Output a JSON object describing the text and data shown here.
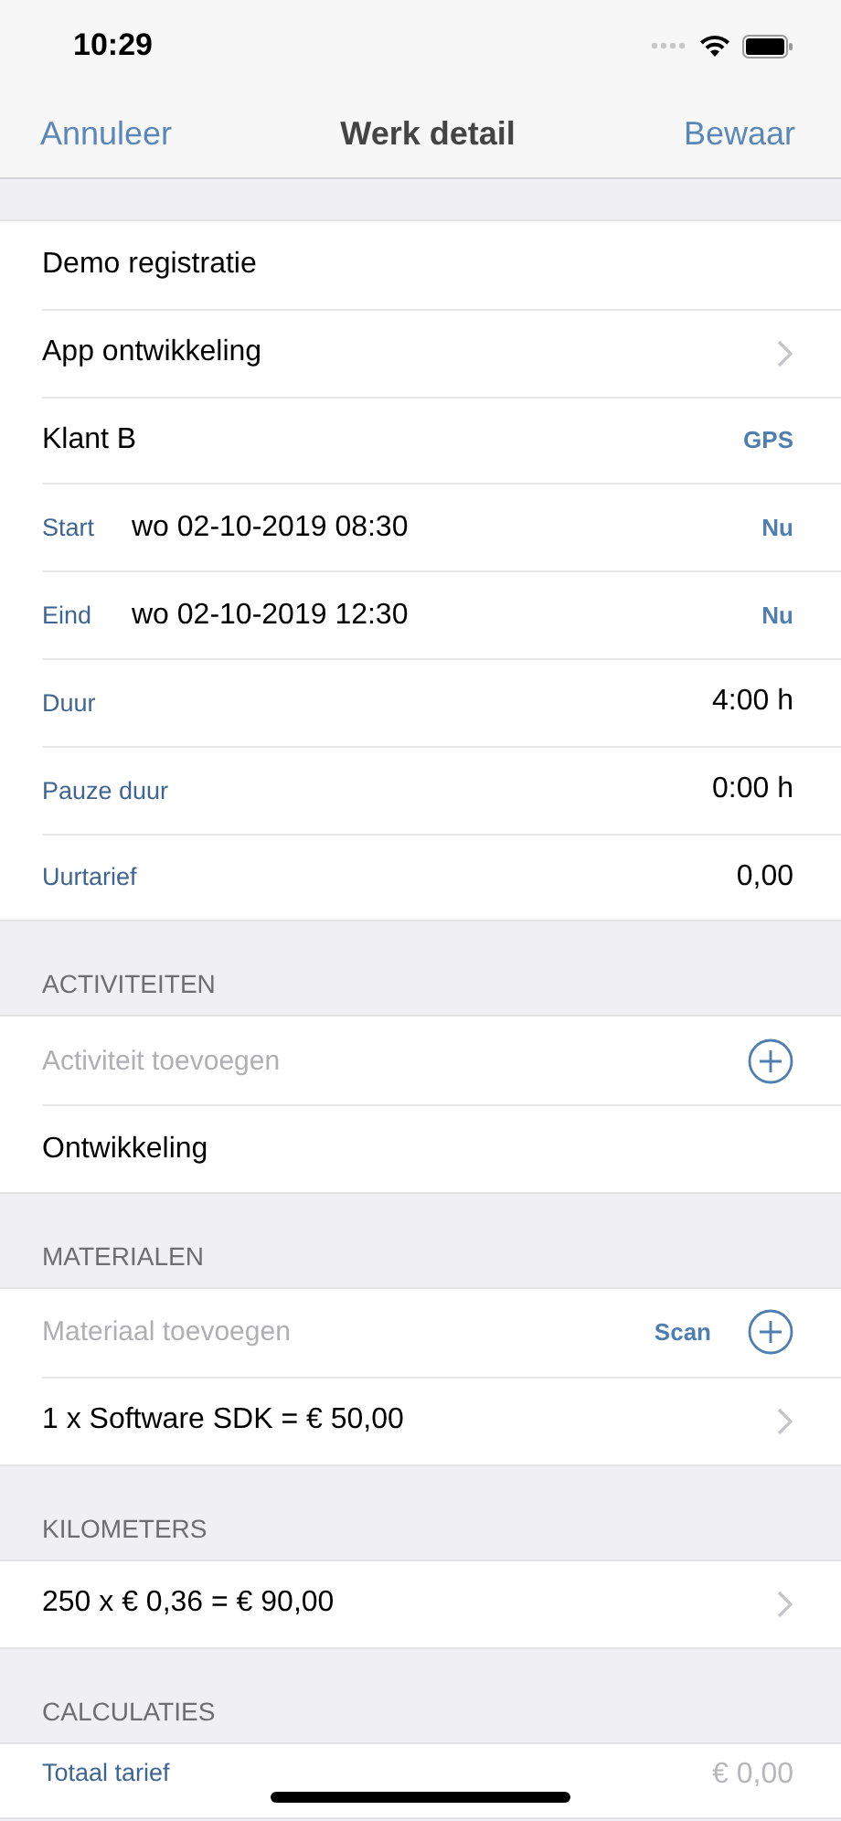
{
  "status_bar": {
    "time": "10:29"
  },
  "nav": {
    "cancel": "Annuleer",
    "title": "Werk detail",
    "save": "Bewaar"
  },
  "sections": [
    {
      "rows": [
        {
          "kind": "plain",
          "text": "Demo registratie"
        },
        {
          "kind": "link",
          "text": "App ontwikkeling"
        },
        {
          "kind": "action",
          "text": "Klant B",
          "action": "GPS"
        },
        {
          "kind": "date",
          "label": "Start",
          "value": "wo 02-10-2019 08:30",
          "action": "Nu"
        },
        {
          "kind": "date",
          "label": "Eind",
          "value": "wo 02-10-2019 12:30",
          "action": "Nu"
        },
        {
          "kind": "value",
          "label": "Duur",
          "value": "4:00 h"
        },
        {
          "kind": "value",
          "label": "Pauze duur",
          "value": "0:00 h"
        },
        {
          "kind": "value",
          "label": "Uurtarief",
          "value": "0,00"
        }
      ]
    },
    {
      "header": "ACTIVITEITEN",
      "rows": [
        {
          "kind": "add",
          "placeholder": "Activiteit toevoegen"
        },
        {
          "kind": "plain",
          "text": "Ontwikkeling"
        }
      ]
    },
    {
      "header": "MATERIALEN",
      "rows": [
        {
          "kind": "add",
          "placeholder": "Materiaal toevoegen",
          "action": "Scan"
        },
        {
          "kind": "link",
          "text": "1 x Software SDK = € 50,00"
        }
      ]
    },
    {
      "header": "KILOMETERS",
      "rows": [
        {
          "kind": "link",
          "text": "250 x € 0,36 = € 90,00"
        }
      ]
    },
    {
      "header": "CALCULATIES",
      "rows": [
        {
          "kind": "total",
          "label": "Totaal tarief",
          "value": "€ 0,00"
        }
      ]
    }
  ]
}
